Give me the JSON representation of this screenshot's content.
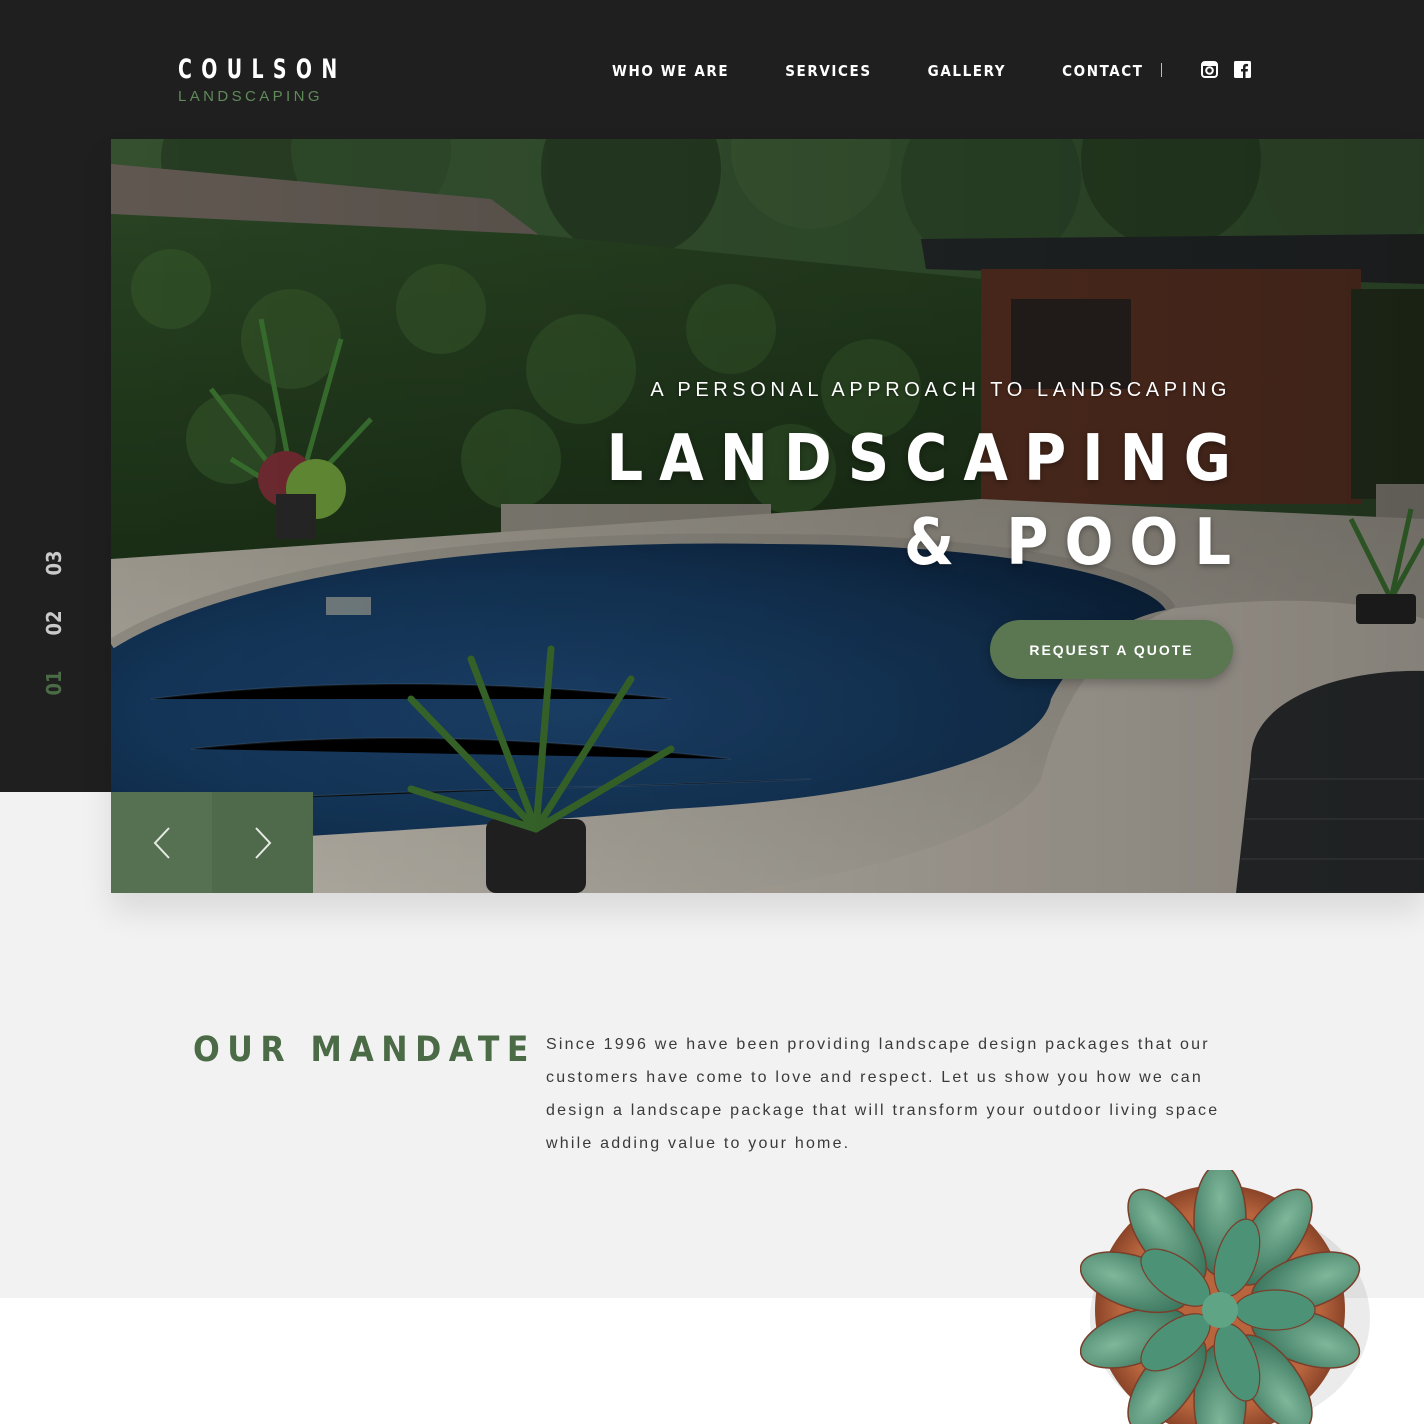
{
  "brand": {
    "name": "COULSON",
    "tagline": "LANDSCAPING"
  },
  "nav": {
    "items": [
      "WHO WE ARE",
      "SERVICES",
      "GALLERY",
      "CONTACT"
    ],
    "social": [
      "instagram-icon",
      "facebook-icon"
    ]
  },
  "slider": {
    "indicators": [
      "03",
      "02",
      "01"
    ],
    "active": "01"
  },
  "hero": {
    "kicker": "A PERSONAL APPROACH TO LANDSCAPING",
    "title_line1": "LANDSCAPING",
    "title_line2": "& POOL",
    "cta": "REQUEST A QUOTE"
  },
  "mandate": {
    "title": "OUR MANDATE",
    "text": "Since 1996 we have been providing landscape design packages that our customers have come to love and respect. Let us show you how we can design a landscape package that will transform your outdoor living space while adding value to your home."
  },
  "colors": {
    "dark": "#1f1f1f",
    "accent_green": "#4a6b46",
    "button_green": "#5a7752",
    "light_bg": "#f2f2f2"
  }
}
